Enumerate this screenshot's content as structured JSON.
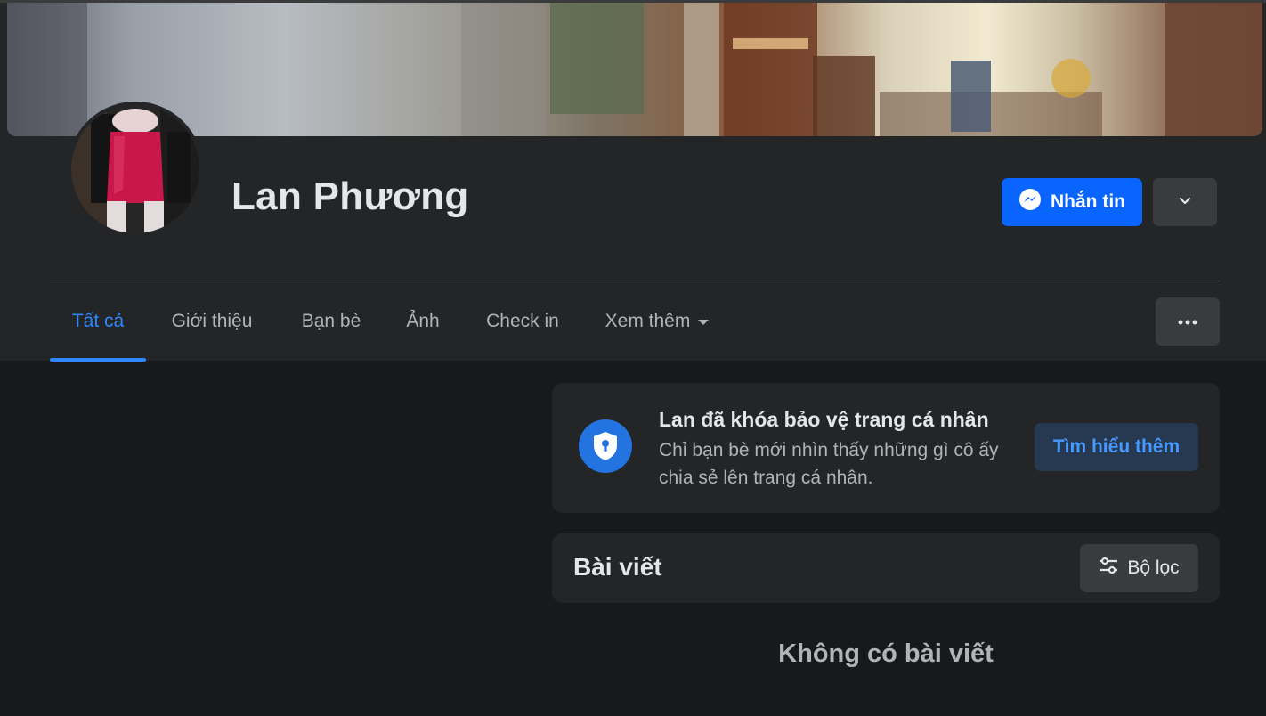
{
  "profile": {
    "name": "Lan Phương"
  },
  "actions": {
    "message_label": "Nhắn tin"
  },
  "tabs": [
    {
      "label": "Tất cả",
      "active": true
    },
    {
      "label": "Giới thiệu",
      "active": false
    },
    {
      "label": "Bạn bè",
      "active": false
    },
    {
      "label": "Ảnh",
      "active": false
    },
    {
      "label": "Check in",
      "active": false
    },
    {
      "label": "Xem thêm",
      "active": false
    }
  ],
  "lock_notice": {
    "title": "Lan đã khóa bảo vệ trang cá nhân",
    "description": "Chỉ bạn bè mới nhìn thấy những gì cô ấy chia sẻ lên trang cá nhân.",
    "button_label": "Tìm hiểu thêm"
  },
  "posts": {
    "title": "Bài viết",
    "filter_label": "Bộ lọc",
    "empty_text": "Không có bài viết"
  },
  "colors": {
    "accent": "#0866ff",
    "active_tab": "#2d88ff",
    "background": "#18191a",
    "surface": "#242526"
  },
  "icons": {
    "message_button": "messenger-icon",
    "dropdown": "chevron-down-icon",
    "more": "more-horizontal-icon",
    "lock": "shield-lock-icon",
    "filter": "filter-sliders-icon",
    "see_more": "caret-down-icon"
  }
}
